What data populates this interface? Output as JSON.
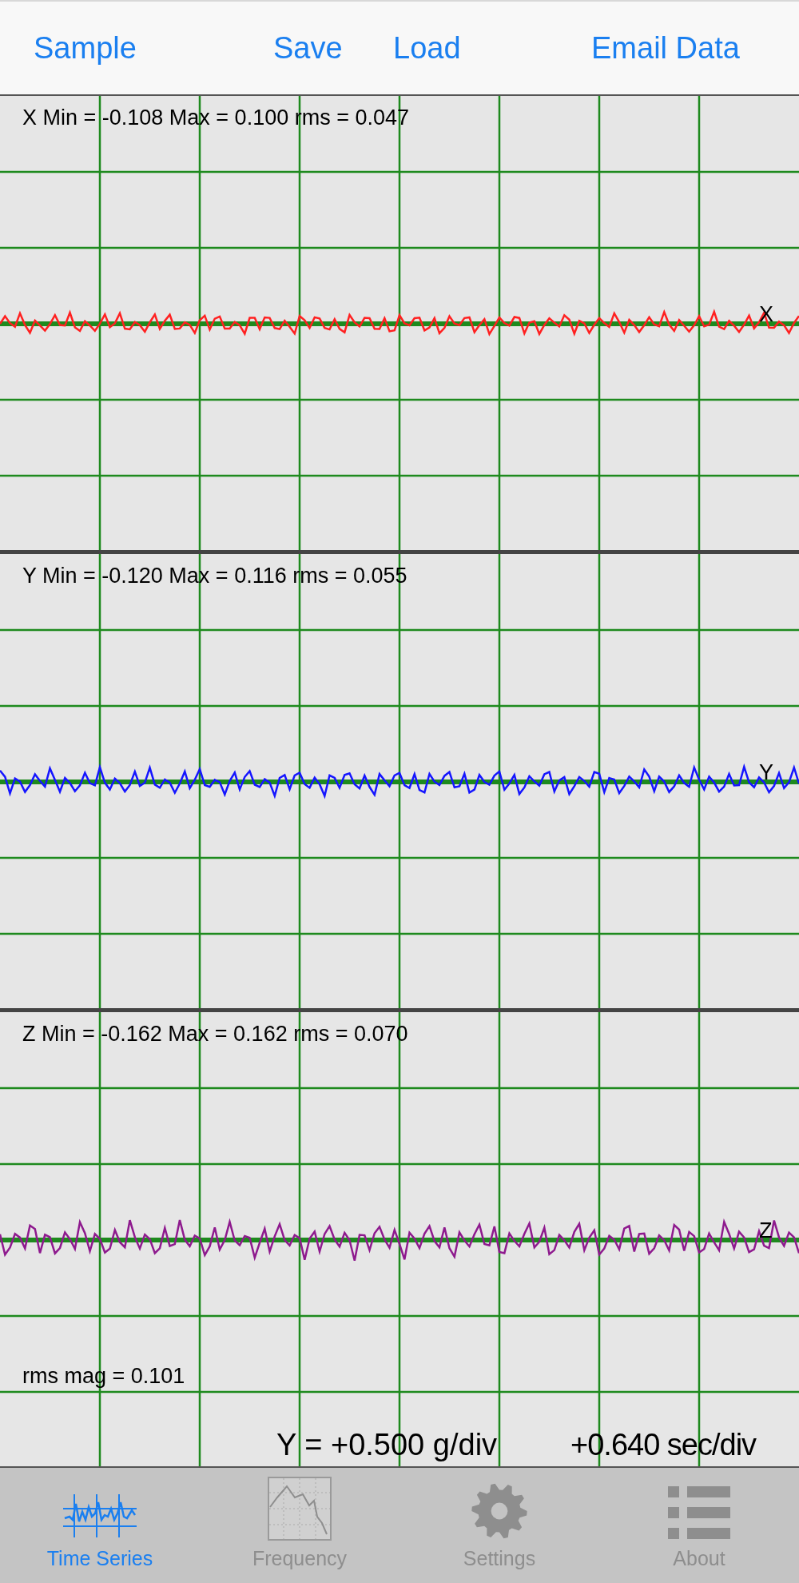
{
  "toolbar": {
    "buttons": [
      "Sample",
      "Save",
      "Load",
      "Email Data"
    ]
  },
  "panels": [
    {
      "axis_label": "X",
      "stats": "X Min = -0.108 Max = 0.100 rms = 0.047",
      "color": "#ff2020"
    },
    {
      "axis_label": "Y",
      "stats": "Y Min = -0.120 Max = 0.116 rms = 0.055",
      "color": "#1515ff"
    },
    {
      "axis_label": "Z",
      "stats": "Z Min = -0.162 Max = 0.162 rms = 0.070",
      "color": "#8e1a8e"
    }
  ],
  "rms_mag": "rms mag = 0.101",
  "scale": {
    "y": "Y = +0.500 g/div",
    "x": "+0.640 sec/div"
  },
  "tabs": [
    {
      "label": "Time Series",
      "kind": "waveform",
      "selected": true
    },
    {
      "label": "Frequency",
      "kind": "spectrum",
      "selected": false
    },
    {
      "label": "Settings",
      "kind": "gear",
      "selected": false
    },
    {
      "label": "About",
      "kind": "list",
      "selected": false
    }
  ]
}
